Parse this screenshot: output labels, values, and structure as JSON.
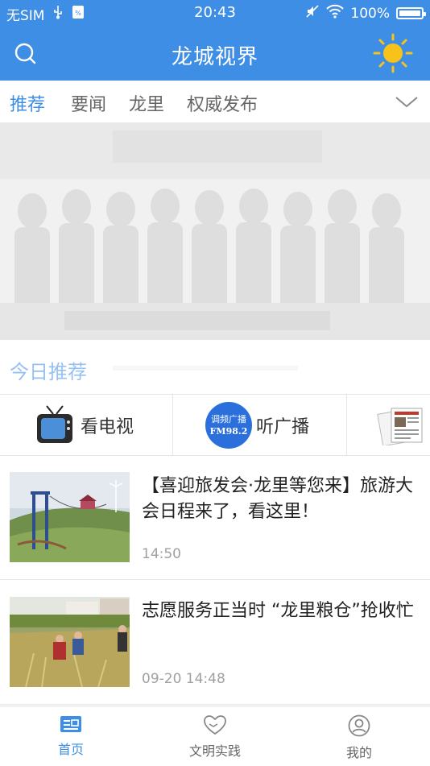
{
  "status_bar": {
    "carrier": "无SIM",
    "time": "20:43",
    "battery": "100%"
  },
  "header": {
    "title": "龙城视界"
  },
  "tabs": [
    {
      "label": "推荐",
      "active": true
    },
    {
      "label": "要闻",
      "active": false
    },
    {
      "label": "龙里",
      "active": false
    },
    {
      "label": "权威发布",
      "active": false
    }
  ],
  "today": {
    "label": "今日推荐"
  },
  "media": {
    "tv_label": "看电视",
    "radio_label": "听广播",
    "radio_badge_line1": "调频广播",
    "radio_badge_line2": "FM98.2"
  },
  "news": [
    {
      "title": "【喜迎旅发会·龙里等您来】旅游大会日程来了，看这里！",
      "time": "14:50"
    },
    {
      "title": "志愿服务正当时 “龙里粮仓”抢收忙",
      "time": "09-20 14:48"
    }
  ],
  "bottom_nav": [
    {
      "label": "首页",
      "active": true
    },
    {
      "label": "文明实践",
      "active": false
    },
    {
      "label": "我的",
      "active": false
    }
  ],
  "colors": {
    "brand": "#3f8ee6",
    "sun": "#f7c31a"
  }
}
